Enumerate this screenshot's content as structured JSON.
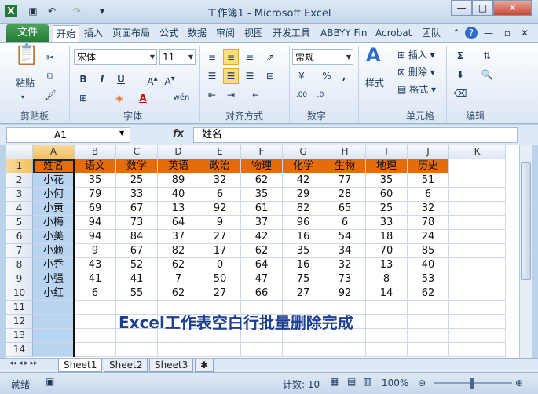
{
  "window": {
    "title": "工作簿1 - Microsoft Excel",
    "min": "—",
    "max": "□",
    "close": "✕"
  },
  "ribbon_tabs": [
    "开始",
    "插入",
    "页面布局",
    "公式",
    "数据",
    "审阅",
    "视图",
    "开发工具",
    "ABBYY Fin",
    "Acrobat",
    "团队"
  ],
  "file_tab": "文件",
  "ribbon": {
    "paste_label": "粘贴",
    "font_name": "宋体",
    "font_size": "11",
    "number_format": "常规",
    "style_label": "样式",
    "insert_label": "插入",
    "delete_label": "删除",
    "format_label": "格式",
    "groups": {
      "clipboard": "剪贴板",
      "font": "字体",
      "alignment": "对齐方式",
      "number": "数字",
      "cells": "单元格",
      "editing": "编辑"
    },
    "bold": "B",
    "italic": "I",
    "underline": "U",
    "wen": "wén"
  },
  "formula_bar": {
    "name_box": "A1",
    "fx": "fx",
    "content": "姓名"
  },
  "columns": [
    "A",
    "B",
    "C",
    "D",
    "E",
    "F",
    "G",
    "H",
    "I",
    "J",
    "K"
  ],
  "rows": [
    "1",
    "2",
    "3",
    "4",
    "5",
    "6",
    "7",
    "8",
    "9",
    "10",
    "11",
    "12",
    "13",
    "14"
  ],
  "table": {
    "headers": [
      "姓名",
      "语文",
      "数学",
      "英语",
      "政治",
      "物理",
      "化学",
      "生物",
      "地理",
      "历史"
    ],
    "data": [
      [
        "小花",
        "35",
        "25",
        "89",
        "32",
        "62",
        "42",
        "77",
        "35",
        "51"
      ],
      [
        "小何",
        "79",
        "33",
        "40",
        "6",
        "35",
        "29",
        "28",
        "60",
        "6"
      ],
      [
        "小黄",
        "69",
        "67",
        "13",
        "92",
        "61",
        "82",
        "65",
        "25",
        "32"
      ],
      [
        "小梅",
        "94",
        "73",
        "64",
        "9",
        "37",
        "96",
        "6",
        "33",
        "78"
      ],
      [
        "小美",
        "94",
        "84",
        "37",
        "27",
        "42",
        "16",
        "54",
        "18",
        "24"
      ],
      [
        "小赖",
        "9",
        "67",
        "82",
        "17",
        "62",
        "35",
        "34",
        "70",
        "85"
      ],
      [
        "小乔",
        "43",
        "52",
        "62",
        "0",
        "64",
        "16",
        "32",
        "13",
        "40"
      ],
      [
        "小强",
        "41",
        "41",
        "7",
        "50",
        "47",
        "75",
        "73",
        "8",
        "53"
      ],
      [
        "小红",
        "6",
        "55",
        "62",
        "27",
        "66",
        "27",
        "92",
        "14",
        "62"
      ]
    ]
  },
  "note": "Excel工作表空白行批量删除完成",
  "sheets": [
    "Sheet1",
    "Sheet2",
    "Sheet3"
  ],
  "status": {
    "mode": "就绪",
    "count": "计数: 10",
    "zoom": "100%"
  },
  "colors": {
    "header_fill": "#e46c0a",
    "selection_fill": "#b8d4f0",
    "note_color": "#1f3f8f"
  }
}
